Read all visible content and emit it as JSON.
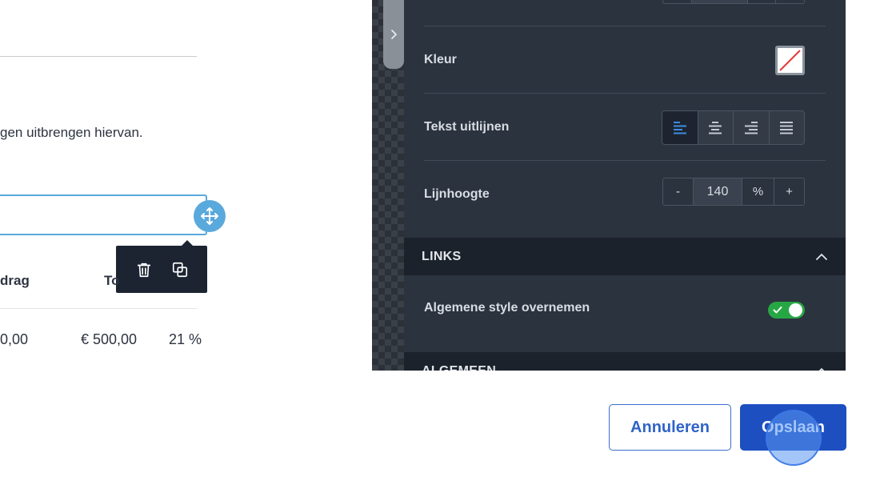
{
  "document": {
    "paragraph_fragment": "gen uitbrengen hiervan.",
    "table": {
      "headers": [
        "drag",
        "To"
      ],
      "row": [
        "0,00",
        "€ 500,00",
        "21 %"
      ]
    },
    "toolbar": {
      "delete_icon": "trash-icon",
      "duplicate_icon": "duplicate-icon",
      "move_icon": "move-icon"
    }
  },
  "panel": {
    "color_label": "Kleur",
    "color_value": "none",
    "align_label": "Tekst uitlijnen",
    "align_options": [
      "left",
      "center",
      "right",
      "justify"
    ],
    "align_selected": "left",
    "lineheight_label": "Lijnhoogte",
    "lineheight": {
      "minus": "-",
      "value": "140",
      "unit": "%",
      "plus": "+"
    },
    "sections": {
      "links_title": "LINKS",
      "general_title": "ALGEMEEN"
    },
    "inherit_label": "Algemene style overnemen",
    "inherit_enabled": true
  },
  "footer": {
    "cancel_label": "Annuleren",
    "save_label": "Opslaan"
  },
  "colors": {
    "accent": "#1e4fc1",
    "toggle_on": "#27a744",
    "panel_bg": "#2b333f",
    "selection": "#5aa9dc"
  }
}
